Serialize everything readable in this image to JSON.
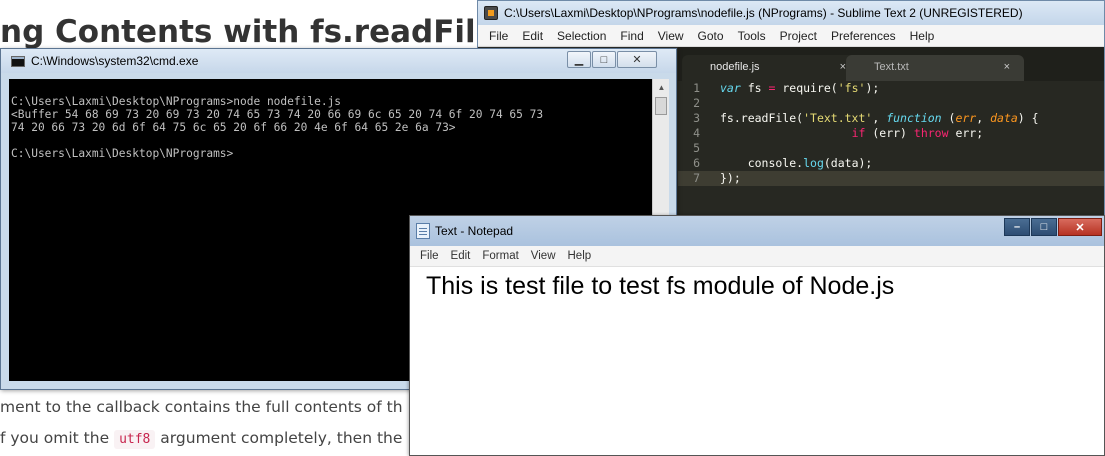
{
  "article": {
    "heading": "ng Contents with fs.readFile",
    "para1": "ment to the callback contains the full contents of th",
    "para2_pre": "f you omit the ",
    "para2_code": "utf8",
    "para2_post": " argument completely, then the"
  },
  "sublime": {
    "title": "C:\\Users\\Laxmi\\Desktop\\NPrograms\\nodefile.js (NPrograms) - Sublime Text 2 (UNREGISTERED)",
    "menu": [
      "File",
      "Edit",
      "Selection",
      "Find",
      "View",
      "Goto",
      "Tools",
      "Project",
      "Preferences",
      "Help"
    ],
    "tabs": [
      {
        "label": "nodefile.js",
        "close": "×"
      },
      {
        "label": "Text.txt",
        "close": "×"
      }
    ],
    "code_lines": [
      {
        "n": "1",
        "html_tokens": [
          [
            "kw",
            "var"
          ],
          [
            "plain",
            " fs "
          ],
          [
            "op",
            "="
          ],
          [
            "plain",
            " require("
          ],
          [
            "str",
            "'fs'"
          ],
          [
            "plain",
            ");"
          ]
        ]
      },
      {
        "n": "2",
        "html_tokens": []
      },
      {
        "n": "3",
        "html_tokens": [
          [
            "plain",
            "fs.readFile("
          ],
          [
            "str",
            "'Text.txt'"
          ],
          [
            "plain",
            ", "
          ],
          [
            "kw",
            "function"
          ],
          [
            "plain",
            " ("
          ],
          [
            "param",
            "err"
          ],
          [
            "plain",
            ", "
          ],
          [
            "param",
            "data"
          ],
          [
            "plain",
            ") {"
          ]
        ]
      },
      {
        "n": "4",
        "html_tokens": [
          [
            "plain",
            "                   "
          ],
          [
            "op",
            "if"
          ],
          [
            "plain",
            " (err) "
          ],
          [
            "op",
            "throw"
          ],
          [
            "plain",
            " err;"
          ]
        ]
      },
      {
        "n": "5",
        "html_tokens": []
      },
      {
        "n": "6",
        "html_tokens": [
          [
            "plain",
            "    console."
          ],
          [
            "fn",
            "log"
          ],
          [
            "plain",
            "(data);"
          ]
        ]
      },
      {
        "n": "7",
        "html_tokens": [
          [
            "plain",
            "});"
          ]
        ]
      }
    ]
  },
  "cmd": {
    "title": "C:\\Windows\\system32\\cmd.exe",
    "btn_min": "▁",
    "btn_max": "□",
    "btn_close": "✕",
    "lines": [
      "",
      "C:\\Users\\Laxmi\\Desktop\\NPrograms>node nodefile.js",
      "<Buffer 54 68 69 73 20 69 73 20 74 65 73 74 20 66 69 6c 65 20 74 6f 20 74 65 73",
      "74 20 66 73 20 6d 6f 64 75 6c 65 20 6f 66 20 4e 6f 64 65 2e 6a 73>",
      "",
      "C:\\Users\\Laxmi\\Desktop\\NPrograms>"
    ],
    "scroll_up": "▲"
  },
  "notepad": {
    "title": "Text - Notepad",
    "btn_min": "–",
    "btn_max": "□",
    "btn_close": "✕",
    "menu": [
      "File",
      "Edit",
      "Format",
      "View",
      "Help"
    ],
    "content": "This is test file to test fs module of Node.js"
  }
}
